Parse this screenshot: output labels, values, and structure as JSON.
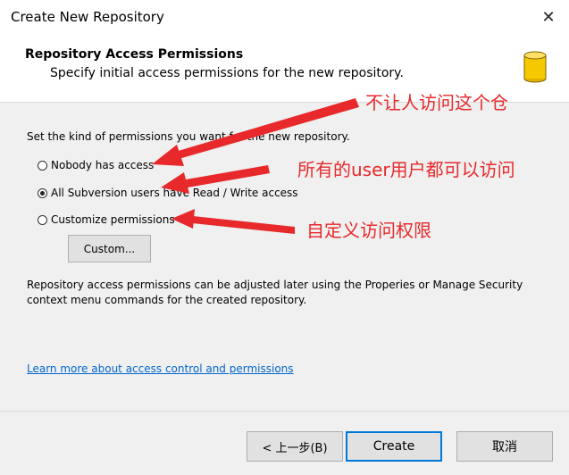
{
  "window": {
    "title": "Create New Repository",
    "close_icon": "close-icon"
  },
  "header": {
    "title": "Repository Access Permissions",
    "subtitle": "Specify initial access permissions for the new repository.",
    "icon": "database-icon"
  },
  "content": {
    "prompt": "Set the kind of permissions you want for the new repository.",
    "options": [
      {
        "label": "Nobody has access",
        "checked": false
      },
      {
        "label": "All Subversion users have Read / Write access",
        "checked": true
      },
      {
        "label": "Customize permissions",
        "checked": false
      }
    ],
    "custom_button": "Custom...",
    "note": "Repository access permissions can be adjusted later using the Properies or Manage Security context menu commands for the created repository.",
    "link": "Learn more about access control and permissions"
  },
  "footer": {
    "back_label": "< 上一步(B)",
    "create_label": "Create",
    "cancel_label": "取消"
  },
  "annotations": {
    "nobody": "不让人访问这个仓",
    "all_users": "所有的user用户都可以访问",
    "custom": "自定义访问权限",
    "color": "#e8292b"
  }
}
